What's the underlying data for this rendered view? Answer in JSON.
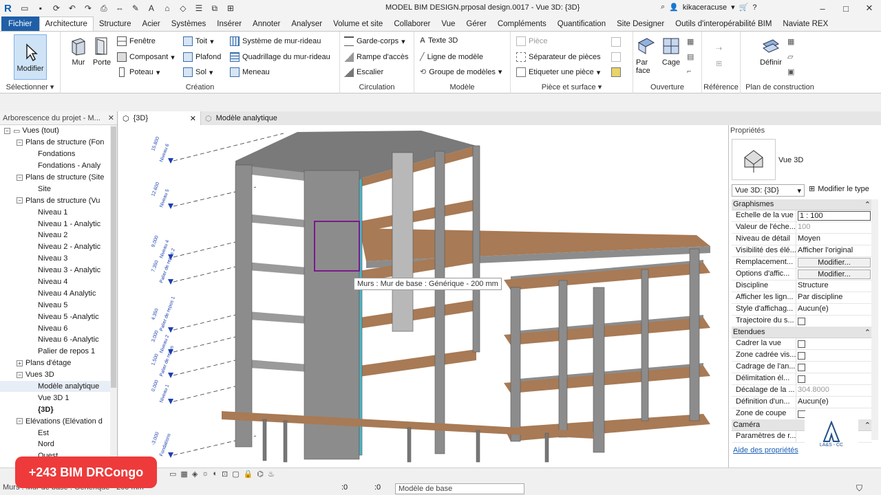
{
  "titlebar": {
    "app_letter": "R",
    "title": "MODEL BIM DESIGN.prposal design.0017 - Vue 3D: {3D}",
    "user": "kikaceracuse",
    "minimize": "–",
    "maximize": "□",
    "close": "✕"
  },
  "tabs": [
    "Fichier",
    "Architecture",
    "Structure",
    "Acier",
    "Systèmes",
    "Insérer",
    "Annoter",
    "Analyser",
    "Volume et site",
    "Collaborer",
    "Vue",
    "Gérer",
    "Compléments",
    "Quantification",
    "Site Designer",
    "Outils d'interopérabilité BIM",
    "Naviate REX"
  ],
  "ribbon": {
    "select": {
      "modify": "Modifier",
      "label": "Sélectionner"
    },
    "creation": {
      "wall": "Mur",
      "door": "Porte",
      "window": "Fenêtre",
      "component": "Composant",
      "column": "Poteau",
      "roof": "Toit",
      "ceiling": "Plafond",
      "floor": "Sol",
      "curtain_system": "Système de mur-rideau",
      "curtain_grid": "Quadrillage du mur-rideau",
      "mullion": "Meneau",
      "label": "Création"
    },
    "circulation": {
      "railing": "Garde-corps",
      "ramp": "Rampe d'accès",
      "stair": "Escalier",
      "label": "Circulation"
    },
    "model": {
      "text": "Texte 3D",
      "line": "Ligne de modèle",
      "group": "Groupe de modèles",
      "label": "Modèle"
    },
    "room": {
      "room": "Pièce",
      "separator": "Séparateur de pièces",
      "tag": "Etiqueter une pièce",
      "label": "Pièce et surface"
    },
    "opening": {
      "by_face": "Par face",
      "shaft": "Cage",
      "label": "Ouverture"
    },
    "reference": {
      "label": "Référence"
    },
    "work_plane": {
      "set": "Définir",
      "label": "Plan de construction"
    }
  },
  "browser": {
    "title": "Arborescence du projet - M...",
    "items": [
      {
        "label": "Vues (tout)",
        "level": 0,
        "toggle": "−"
      },
      {
        "label": "Plans de structure (Fon",
        "level": 1,
        "toggle": "−"
      },
      {
        "label": "Fondations",
        "level": 2,
        "toggle": ""
      },
      {
        "label": "Fondations - Analy",
        "level": 2,
        "toggle": ""
      },
      {
        "label": "Plans de structure (Site",
        "level": 1,
        "toggle": "−"
      },
      {
        "label": "Site",
        "level": 2,
        "toggle": ""
      },
      {
        "label": "Plans de structure (Vu",
        "level": 1,
        "toggle": "−"
      },
      {
        "label": "Niveau 1",
        "level": 2,
        "toggle": ""
      },
      {
        "label": "Niveau 1 - Analytic",
        "level": 2,
        "toggle": ""
      },
      {
        "label": "Niveau 2",
        "level": 2,
        "toggle": ""
      },
      {
        "label": "Niveau 2 - Analytic",
        "level": 2,
        "toggle": ""
      },
      {
        "label": "Niveau 3",
        "level": 2,
        "toggle": ""
      },
      {
        "label": "Niveau 3 - Analytic",
        "level": 2,
        "toggle": ""
      },
      {
        "label": "Niveau 4",
        "level": 2,
        "toggle": ""
      },
      {
        "label": "Niveau 4  Analytic",
        "level": 2,
        "toggle": ""
      },
      {
        "label": "Niveau 5",
        "level": 2,
        "toggle": ""
      },
      {
        "label": "Niveau 5 -Analytic",
        "level": 2,
        "toggle": ""
      },
      {
        "label": "Niveau 6",
        "level": 2,
        "toggle": ""
      },
      {
        "label": "Niveau 6 -Analytic",
        "level": 2,
        "toggle": ""
      },
      {
        "label": "Palier de repos 1",
        "level": 2,
        "toggle": ""
      },
      {
        "label": "Plans d'étage",
        "level": 1,
        "toggle": "+"
      },
      {
        "label": "Vues 3D",
        "level": 1,
        "toggle": "−"
      },
      {
        "label": "Modèle analytique",
        "level": 2,
        "toggle": "",
        "selected": true
      },
      {
        "label": "Vue 3D 1",
        "level": 2,
        "toggle": ""
      },
      {
        "label": "{3D}",
        "level": 2,
        "toggle": "",
        "bold": true
      },
      {
        "label": "Elévations (Elévation d",
        "level": 1,
        "toggle": "−"
      },
      {
        "label": "Est",
        "level": 2,
        "toggle": ""
      },
      {
        "label": "Nord",
        "level": 2,
        "toggle": ""
      },
      {
        "label": "Ouest",
        "level": 2,
        "toggle": ""
      }
    ]
  },
  "view_tabs": [
    {
      "label": "{3D}",
      "close": "✕"
    },
    {
      "label": "Modèle analytique",
      "close": ""
    }
  ],
  "viewport": {
    "tooltip": "Murs : Mur de base : Générique - 200 mm",
    "levels": [
      {
        "elev": "15.800",
        "name": "Niveau 6"
      },
      {
        "elev": "12.600",
        "name": "Niveau 5"
      },
      {
        "elev": "9.000",
        "name": "Niveau 4"
      },
      {
        "elev": "7.350",
        "name": "Palier de repos 2"
      },
      {
        "elev": "4.350",
        "name": "Palier de repos 1"
      },
      {
        "elev": "3.000",
        "name": "Niveau 2"
      },
      {
        "elev": "1.500",
        "name": "Palier de repos"
      },
      {
        "elev": "0.000",
        "name": "Niveau 1"
      },
      {
        "elev": "-3.000",
        "name": "Fondations"
      }
    ]
  },
  "properties": {
    "title": "Propriétés",
    "type_name": "Vue 3D",
    "view_dropdown": "Vue 3D: {3D}",
    "edit_type": "Modifier le type",
    "groups": [
      {
        "name": "Graphismes",
        "rows": [
          {
            "name": "Echelle de la vue",
            "value": "1 : 100",
            "kind": "field"
          },
          {
            "name": "Valeur de l'éche...",
            "value": "100",
            "kind": "grey"
          },
          {
            "name": "Niveau de détail",
            "value": "Moyen",
            "kind": "text"
          },
          {
            "name": "Visibilité des élé...",
            "value": "Afficher l'original",
            "kind": "text"
          },
          {
            "name": "Remplacement...",
            "value": "Modifier...",
            "kind": "btn"
          },
          {
            "name": "Options d'affic...",
            "value": "Modifier...",
            "kind": "btn"
          },
          {
            "name": "Discipline",
            "value": "Structure",
            "kind": "text"
          },
          {
            "name": "Afficher les lign...",
            "value": "Par discipline",
            "kind": "text"
          },
          {
            "name": "Style d'affichag...",
            "value": "Aucun(e)",
            "kind": "text"
          },
          {
            "name": "Trajectoire du s...",
            "value": "",
            "kind": "chk"
          }
        ]
      },
      {
        "name": "Etendues",
        "rows": [
          {
            "name": "Cadrer la vue",
            "value": "",
            "kind": "chk"
          },
          {
            "name": "Zone cadrée vis...",
            "value": "",
            "kind": "chk"
          },
          {
            "name": "Cadrage de l'an...",
            "value": "",
            "kind": "chk"
          },
          {
            "name": "Délimitation él...",
            "value": "",
            "kind": "chk"
          },
          {
            "name": "Décalage de la ...",
            "value": "304.8000",
            "kind": "grey"
          },
          {
            "name": "Définition d'un...",
            "value": "Aucun(e)",
            "kind": "text"
          },
          {
            "name": "Zone de coupe",
            "value": "",
            "kind": "chk"
          }
        ]
      },
      {
        "name": "Caméra",
        "rows": [
          {
            "name": "Paramètres de r...",
            "value": "",
            "kind": "text"
          }
        ]
      }
    ],
    "help": "Aide des propriétés",
    "apply": "quer",
    "watermark": "LA&S - CC"
  },
  "status": {
    "text": "Murs : Mur de base : Générique - 200 mm",
    "selection_count": ":0",
    "filter_count": ":0",
    "model": "Modèle de base"
  },
  "banner": "+243 BIM DRCongo",
  "colors": {
    "accent": "#1f5fa8",
    "banner": "#ee3a3a",
    "slab": "#a87a55",
    "concrete": "#8c8c8c"
  }
}
